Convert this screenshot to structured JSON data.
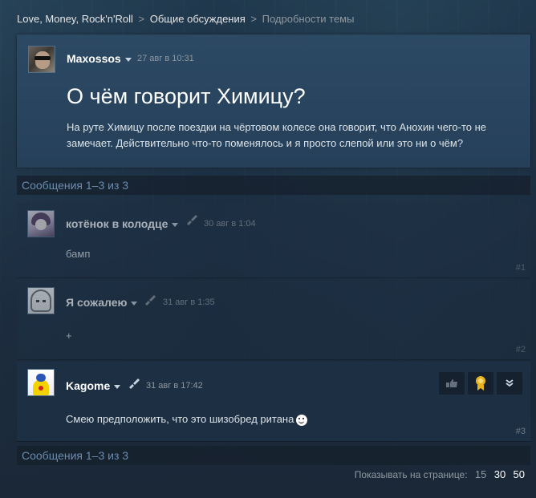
{
  "breadcrumb": {
    "items": [
      "Love, Money, Rock'n'Roll",
      "Общие обсуждения",
      "Подробности темы"
    ],
    "separator": ">"
  },
  "topic": {
    "author": "Maxossos",
    "date": "27 авг в 10:31",
    "title": "О чём говорит Химицу?",
    "body": "На руте Химицу после поездки на чёртовом колесе она говорит, что Анохин чего-то не замечает. Действительно что-то поменялось и я просто слепой или это ни о чём?"
  },
  "messages_count_top": "Сообщения 1–3 из 3",
  "messages_count_bottom": "Сообщения 1–3 из 3",
  "comments": [
    {
      "author": "котёнок в колодце",
      "date": "30 авг в 1:04",
      "text": "бамп",
      "number": "#1"
    },
    {
      "author": "Я сожалею",
      "date": "31 авг в 1:35",
      "text": "+",
      "number": "#2"
    },
    {
      "author": "Kagome",
      "date": "31 авг в 17:42",
      "text": "Смею предположить, что это шизобред ритана",
      "number": "#3"
    }
  ],
  "pager": {
    "label": "Показывать на странице:",
    "options": [
      "15",
      "30",
      "50"
    ]
  },
  "colors": {
    "background": "#1b2838",
    "topic_panel": "#2c4963",
    "count_text": "#6c8cae"
  },
  "icons": [
    "caret-down-icon",
    "brush-badge-icon",
    "thumb-icon",
    "award-icon",
    "chevron-down-double-icon",
    "smiley-icon"
  ]
}
